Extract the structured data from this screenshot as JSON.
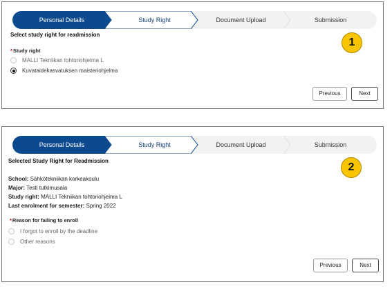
{
  "steps": [
    "Personal Details",
    "Study Right",
    "Document Upload",
    "Submission"
  ],
  "colors": {
    "active": "#0b4a8f",
    "todo": "#f2f2f2",
    "badge": "#f9c500"
  },
  "panel1": {
    "badge": "1",
    "title": "Select study right for readmission",
    "field_label": "Study right",
    "required_mark": "*",
    "options": [
      "MALLI Tekniikan tohtoriohjelma L",
      "Kuvataidekasvatuksen maisteriohjelma"
    ],
    "selected_option": "Kuvataidekasvatuksen maisteriohjelma",
    "previous_label": "Previous",
    "next_label": "Next"
  },
  "panel2": {
    "badge": "2",
    "title": "Selected Study Right for Readmission",
    "info": [
      {
        "key": "School:",
        "value": "Sähkötekniikan korkeakoulu"
      },
      {
        "key": "Major:",
        "value": "Testi tutkimusala"
      },
      {
        "key": "Study right:",
        "value": "MALLI Tekniikan tohtoriohjelma L"
      },
      {
        "key": "Last enrolment for semester:",
        "value": "Spring 2022"
      }
    ],
    "field_label": "Reason for failing to enroll",
    "required_mark": "*",
    "options": [
      "I forgot to enroll by the deadline",
      "Other reasons"
    ],
    "previous_label": "Previous",
    "next_label": "Next"
  }
}
